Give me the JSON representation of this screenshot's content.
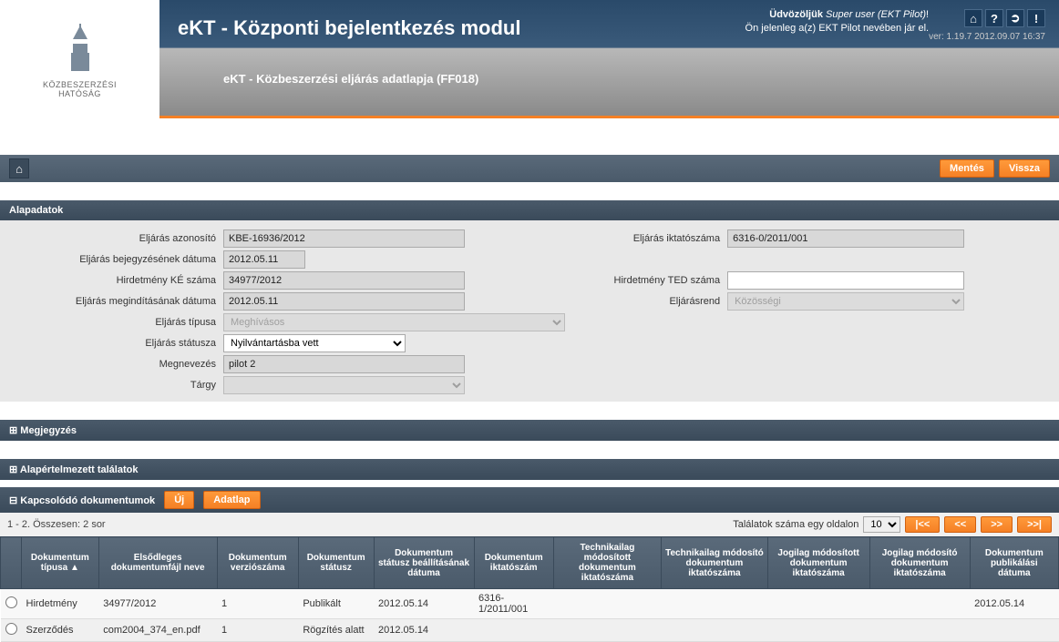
{
  "logo": {
    "line1": "KÖZBESZERZÉSI",
    "line2": "HATÓSÁG"
  },
  "header": {
    "app_title": "eKT - Központi bejelentkezés modul",
    "page_title": "eKT - Közbeszerzési eljárás adatlapja (FF018)",
    "welcome_prefix": "Üdvözöljük ",
    "welcome_user": "Super user (EKT Pilot)",
    "welcome_suffix": "!",
    "impersonation": "Ön jelenleg a(z) EKT Pilot nevében jár el.",
    "version": "ver: 1.19.7 2012.09.07 16:37"
  },
  "toolbar": {
    "save": "Mentés",
    "back": "Vissza"
  },
  "sections": {
    "alapadatok": "Alapadatok",
    "megjegyzes": "Megjegyzés",
    "alapertelmezett": "Alapértelmezett találatok",
    "docs": "Kapcsolódó dokumentumok"
  },
  "form": {
    "labels": {
      "eljaras_azonosito": "Eljárás azonosító",
      "eljaras_bejegyzes_datum": "Eljárás bejegyzésének dátuma",
      "hirdetmeny_ke": "Hirdetmény KÉ száma",
      "eljaras_megindit_datum": "Eljárás megindításának dátuma",
      "eljaras_tipusa": "Eljárás típusa",
      "eljaras_statusza": "Eljárás státusza",
      "megnevezes": "Megnevezés",
      "targy": "Tárgy",
      "eljaras_iktatoszam": "Eljárás iktatószáma",
      "hirdetmeny_ted": "Hirdetmény TED száma",
      "eljarasrend": "Eljárásrend"
    },
    "values": {
      "eljaras_azonosito": "KBE-16936/2012",
      "eljaras_bejegyzes_datum": "2012.05.11",
      "hirdetmeny_ke": "34977/2012",
      "eljaras_megindit_datum": "2012.05.11",
      "eljaras_tipusa": "Meghívásos",
      "eljaras_statusza": "Nyilvántartásba vett",
      "megnevezes": "pilot 2",
      "targy": "",
      "eljaras_iktatoszam": "6316-0/2011/001",
      "hirdetmeny_ted": "",
      "eljarasrend": "Közösségi"
    }
  },
  "docs": {
    "new_btn": "Új",
    "details_btn": "Adatlap",
    "count_text": "1 - 2. Összesen: 2 sor",
    "page_size_label": "Találatok száma egy oldalon",
    "page_size": "10",
    "nav_first": "|<<",
    "nav_prev": "<<",
    "nav_next": ">>",
    "nav_last": ">>|",
    "columns": [
      "Dokumentum típusa ▲",
      "Elsődleges dokumentumfájl neve",
      "Dokumentum verziószáma",
      "Dokumentum státusz",
      "Dokumentum státusz beállításának dátuma",
      "Dokumentum iktatószám",
      "Technikailag módosított dokumentum iktatószáma",
      "Technikailag módosító dokumentum iktatószáma",
      "Jogilag módosított dokumentum iktatószáma",
      "Jogilag módosító dokumentum iktatószáma",
      "Dokumentum publikálási dátuma"
    ],
    "rows": [
      {
        "tipus": "Hirdetmény",
        "fajl": "34977/2012",
        "ver": "1",
        "status": "Publikált",
        "status_date": "2012.05.14",
        "iktato": "6316-1/2011/001",
        "tech_mod_ed": "",
        "tech_mod_ing": "",
        "jog_mod_ed": "",
        "jog_mod_ing": "",
        "pub_date": "2012.05.14"
      },
      {
        "tipus": "Szerződés",
        "fajl": "com2004_374_en.pdf",
        "ver": "1",
        "status": "Rögzítés alatt",
        "status_date": "2012.05.14",
        "iktato": "",
        "tech_mod_ed": "",
        "tech_mod_ing": "",
        "jog_mod_ed": "",
        "jog_mod_ing": "",
        "pub_date": ""
      }
    ]
  }
}
